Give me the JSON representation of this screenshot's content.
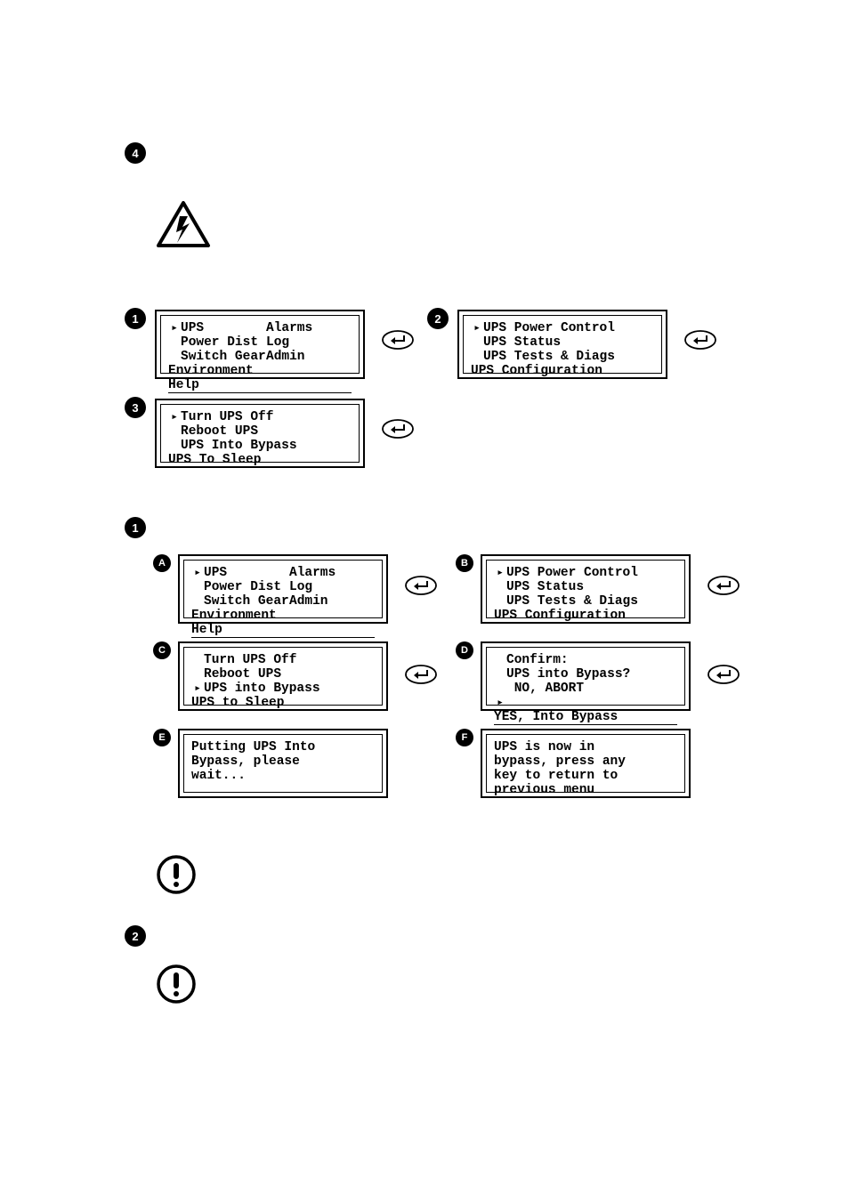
{
  "heading_marker": "4",
  "heading_text": "",
  "menu_grid": {
    "col1": [
      "UPS",
      "Power Dist",
      "Switch Gear",
      "Environment"
    ],
    "col2": [
      "Alarms",
      "Log",
      "Admin",
      "Help"
    ],
    "selected_row": 0
  },
  "power_control_menu": [
    "UPS Power Control",
    "UPS Status",
    "UPS Tests & Diags",
    "UPS Configuration"
  ],
  "power_control_selected": 0,
  "actions_menu_1": [
    "Turn UPS Off",
    "Reboot UPS",
    "UPS Into Bypass",
    "UPS To Sleep"
  ],
  "actions_menu_1_selected": 0,
  "actions_menu_2": [
    "Turn UPS Off",
    "Reboot UPS",
    "UPS into Bypass",
    "UPS to Sleep"
  ],
  "actions_menu_2_selected": 2,
  "confirm": {
    "title": "Confirm:",
    "question": "UPS into Bypass?",
    "no": " NO, ABORT",
    "yes": "YES, Into Bypass",
    "selected": "yes"
  },
  "status_putting": [
    "Putting UPS Into",
    "Bypass, please",
    "wait..."
  ],
  "status_done": [
    "UPS is now in",
    "bypass, press any",
    "key to return to",
    "previous menu"
  ],
  "step_numbers": {
    "one": "1",
    "two": "2",
    "three": "3"
  },
  "step_letters": {
    "A": "A",
    "B": "B",
    "C": "C",
    "D": "D",
    "E": "E",
    "F": "F"
  },
  "sub2_marker": "2"
}
